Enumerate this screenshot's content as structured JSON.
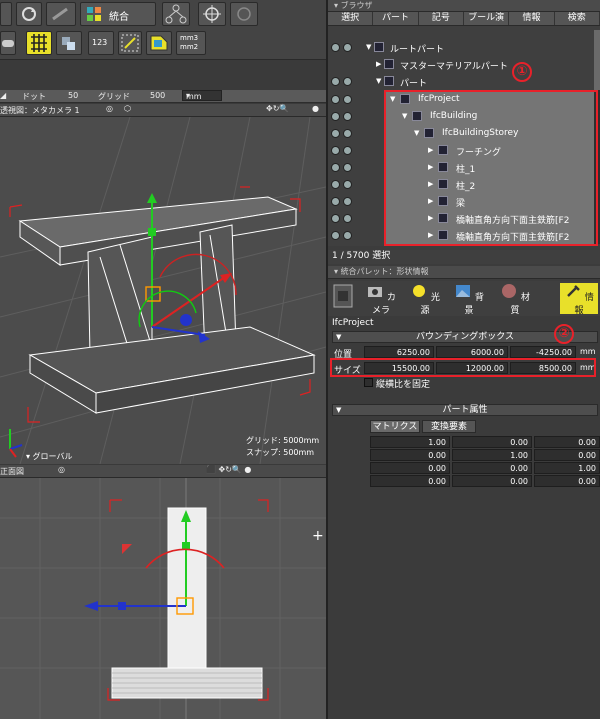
{
  "toolbar": {
    "group_label": "統合",
    "mm_label_1": "mm3",
    "mm_label_2": "mm2",
    "num_label": "123"
  },
  "gridbar": {
    "dot_label": "ドット",
    "dot_value": "50",
    "grid_label": "グリッド",
    "grid_value": "500",
    "unit": "mm"
  },
  "persp_view": {
    "title": "透視図：メタカメラ 1",
    "global_label": "▾ グローバル",
    "grid_readout": "グリッド: 5000mm",
    "snap_readout": "スナップ: 500mm"
  },
  "front_view": {
    "title": "正面図"
  },
  "browser": {
    "title": "ブラウザ",
    "menu": [
      "選択",
      "パート",
      "記号",
      "ブール演",
      "情報",
      "検索"
    ],
    "tree": [
      {
        "label": "ルートパート",
        "indent": 0
      },
      {
        "label": "マスターマテリアルパート",
        "indent": 1
      },
      {
        "label": "パート",
        "indent": 1
      },
      {
        "label": "IfcProject",
        "indent": 2
      },
      {
        "label": "IfcBuilding",
        "indent": 3
      },
      {
        "label": "IfcBuildingStorey",
        "indent": 4
      },
      {
        "label": "フーチング",
        "indent": 5
      },
      {
        "label": "柱_1",
        "indent": 5
      },
      {
        "label": "柱_2",
        "indent": 5
      },
      {
        "label": "梁",
        "indent": 5
      },
      {
        "label": "橋軸直角方向下面主鉄筋[F2",
        "indent": 5
      },
      {
        "label": "橋軸直角方向下面主鉄筋[F2",
        "indent": 5
      }
    ],
    "status": "1 / 5700 選択"
  },
  "callouts": {
    "one": "①",
    "two": "②"
  },
  "palette": {
    "title": "統合パレット：形状情報",
    "tabs": [
      "カメラ",
      "光源",
      "背景",
      "材質",
      "情報"
    ],
    "object_name": "IfcProject",
    "bbox_header": "バウンディングボックス",
    "position_label": "位置",
    "position": [
      "6250.00",
      "6000.00",
      "-4250.00"
    ],
    "size_label": "サイズ",
    "size": [
      "15500.00",
      "12000.00",
      "8500.00"
    ],
    "unit": "mm",
    "ratio_label": "縦横比を固定",
    "part_attr_header": "パート属性",
    "subtabs": [
      "マトリクス",
      "変換要素"
    ],
    "matrix": [
      [
        "1.00",
        "0.00",
        "0.00"
      ],
      [
        "0.00",
        "1.00",
        "0.00"
      ],
      [
        "0.00",
        "0.00",
        "1.00"
      ],
      [
        "0.00",
        "0.00",
        "0.00"
      ]
    ]
  },
  "colors": {
    "accent_yellow": "#e8e02a",
    "callout_red": "#e8212a",
    "panel_bg": "#3c3c3c"
  }
}
